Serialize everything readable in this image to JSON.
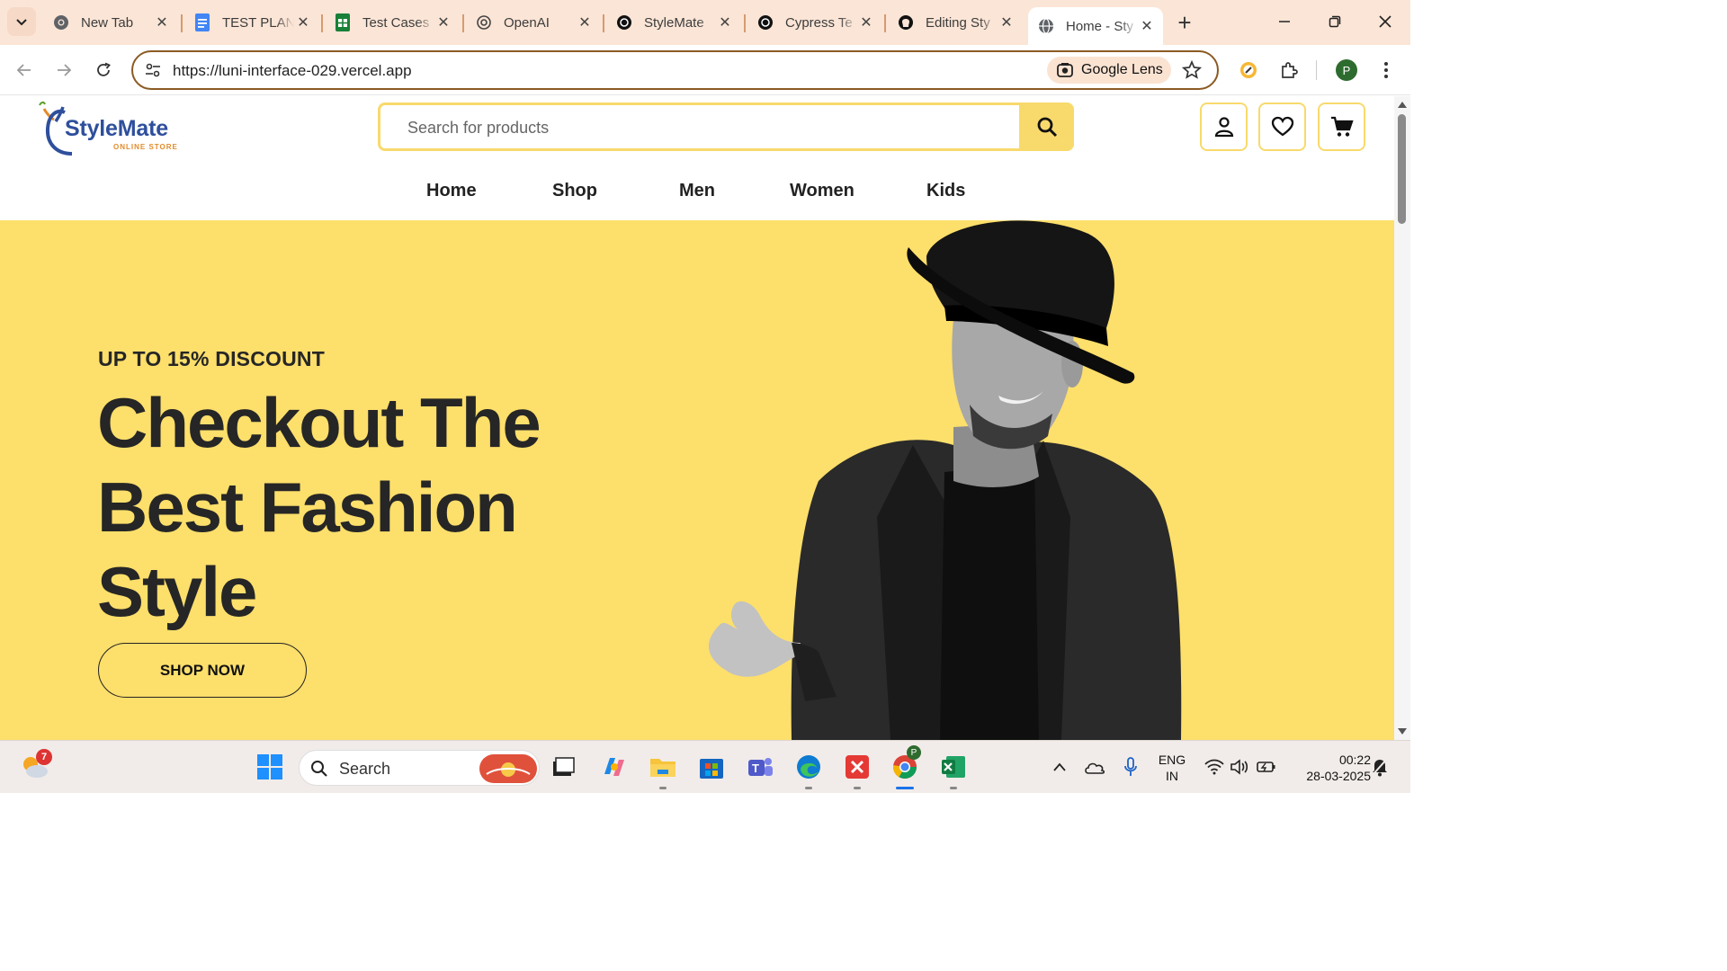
{
  "browser": {
    "tabs": [
      {
        "title": "New Tab",
        "icon": "chrome-icon"
      },
      {
        "title": "TEST PLAN",
        "icon": "google-docs-icon"
      },
      {
        "title": "Test Cases",
        "icon": "google-sheets-icon"
      },
      {
        "title": "OpenAI",
        "icon": "openai-icon"
      },
      {
        "title": "StyleMate",
        "icon": "openai-icon"
      },
      {
        "title": "Cypress Te",
        "icon": "openai-icon"
      },
      {
        "title": "Editing Sty",
        "icon": "github-icon"
      },
      {
        "title": "Home - Sty",
        "icon": "globe-icon",
        "active": true
      }
    ],
    "url": "https://luni-interface-029.vercel.app",
    "lens_label": "Google Lens",
    "profile_initial": "P"
  },
  "site": {
    "logo": {
      "brand": "StyleMate",
      "tagline": "ONLINE STORE"
    },
    "search": {
      "placeholder": "Search for products"
    },
    "nav": [
      "Home",
      "Shop",
      "Men",
      "Women",
      "Kids"
    ],
    "hero": {
      "eyebrow": "UP TO 15% DISCOUNT",
      "headline": "Checkout The Best Fashion Style",
      "cta": "SHOP NOW"
    }
  },
  "taskbar": {
    "weather_badge": "7",
    "search_label": "Search",
    "language": "ENG",
    "region": "IN",
    "time": "00:22",
    "date": "28-03-2025",
    "chrome_badge": "P"
  },
  "colors": {
    "accent_yellow": "#fddf6b",
    "tabstrip": "#fbe5d6",
    "brand_blue": "#2e4f9c",
    "brand_orange": "#e38b2a"
  }
}
